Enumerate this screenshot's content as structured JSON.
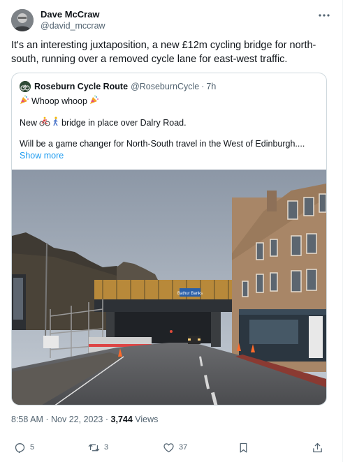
{
  "author": {
    "display_name": "Dave McCraw",
    "handle": "@david_mccraw"
  },
  "tweet": {
    "text": "It's an interesting juxtaposition, a new £12m cycling bridge for north-south, running over a removed cycle lane for east-west traffic."
  },
  "quoted": {
    "name": "Roseburn Cycle Route",
    "handle": "@RoseburnCycle",
    "separator": "·",
    "time": "7h",
    "line1": "Whoop whoop",
    "line2_prefix": "New",
    "line2_suffix": "bridge in place over Dalry Road.",
    "line3": "Will be a game changer for North-South travel in the West of Edinburgh....",
    "show_more": "Show more",
    "photo_sign": "Bathur Banks"
  },
  "meta": {
    "time": "8:58 AM",
    "sep1": "·",
    "date": "Nov 22, 2023",
    "sep2": "·",
    "views_count": "3,744",
    "views_label": "Views"
  },
  "actions": {
    "replies": "5",
    "reposts": "3",
    "likes": "37"
  },
  "icons": [
    "more-icon",
    "reply-icon",
    "repost-icon",
    "like-icon",
    "bookmark-icon",
    "share-icon",
    "party-emoji-icon",
    "bicycle-emoji-icon",
    "walker-emoji-icon"
  ],
  "colors": {
    "text": "#0f1419",
    "secondary": "#536471",
    "link": "#1d9bf0",
    "border": "#cfd9de"
  }
}
